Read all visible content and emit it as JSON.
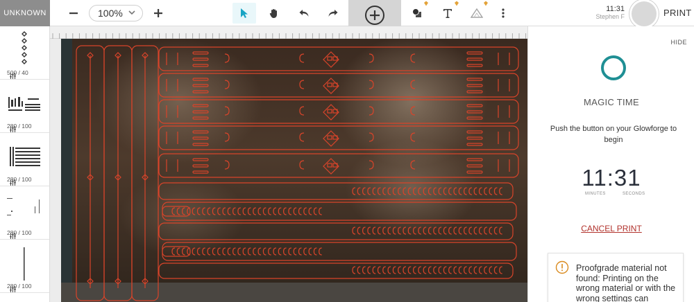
{
  "material": {
    "label": "UNKNOWN"
  },
  "toolbar": {
    "zoom_value": "100%",
    "zoom_out_icon": "minus-icon",
    "zoom_in_icon": "plus-icon",
    "tools": [
      "select-arrow-icon",
      "hand-pan-icon",
      "undo-icon",
      "redo-icon",
      "add-circle-icon",
      "shapes-icon",
      "text-icon",
      "trace-icon",
      "more-vertical-icon"
    ]
  },
  "clock": {
    "time": "11:31",
    "user": "Stephen F"
  },
  "print": {
    "label": "PRINT"
  },
  "sidebar": {
    "items": [
      {
        "label": "500 / 40"
      },
      {
        "label": "280 / 100"
      },
      {
        "label": "280 / 100"
      },
      {
        "label": "280 / 100"
      },
      {
        "label": "280 / 100"
      }
    ]
  },
  "panel": {
    "hide_label": "HIDE",
    "title": "MAGIC TIME",
    "instruction": "Push the button on your Glowforge to begin",
    "timer": {
      "minutes": "11",
      "seconds": "31",
      "minutes_label": "MINUTES",
      "seconds_label": "SECONDS"
    },
    "cancel_label": "CANCEL PRINT",
    "warning": "Proofgrade material not found: Printing on the wrong material or with the wrong settings can"
  },
  "colors": {
    "accent": "#1f8f94",
    "cut_lines": "#d9442a",
    "cancel": "#b1312b",
    "warning": "#d98a1e"
  }
}
